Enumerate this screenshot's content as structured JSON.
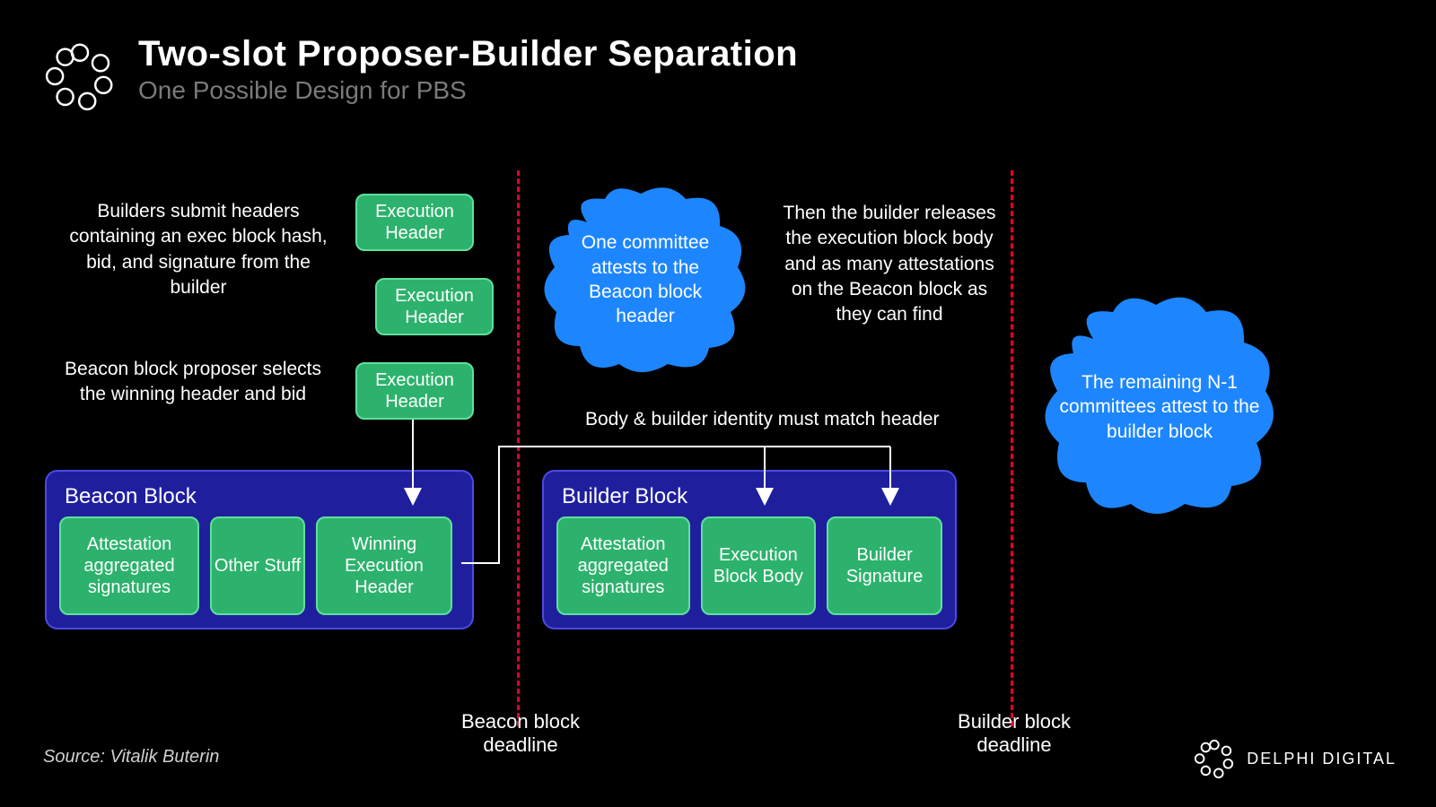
{
  "header": {
    "title": "Two-slot Proposer-Builder Separation",
    "subtitle": "One Possible Design for PBS"
  },
  "desc_builders": "Builders submit headers containing an exec block hash, bid, and signature from the builder",
  "desc_proposer": "Beacon block proposer selects the winning header and bid",
  "desc_release": "Then the builder releases the execution block body and as many attestations on the Beacon block as they can find",
  "exec_headers": [
    "Execution Header",
    "Execution Header",
    "Execution Header"
  ],
  "beacon_block": {
    "title": "Beacon Block",
    "cells": [
      "Attestation aggregated signatures",
      "Other Stuff",
      "Winning Execution Header"
    ]
  },
  "builder_block": {
    "title": "Builder Block",
    "cells": [
      "Attestation aggregated signatures",
      "Execution Block Body",
      "Builder Signature"
    ]
  },
  "cloud1": "One committee attests to the Beacon block header",
  "cloud2": "The remaining N-1 committees attest to the builder block",
  "match_annot": "Body & builder identity must match header",
  "deadline1": "Beacon block deadline",
  "deadline2": "Builder block deadline",
  "source": "Source: Vitalik Buterin",
  "brand": "DELPHI DIGITAL",
  "colors": {
    "green": "#2cb26c",
    "green_border": "#5fe09b",
    "blue_block": "#1f1f9e",
    "blue_block_border": "#4a4ae6",
    "cloud": "#1d86ff",
    "red": "#e4002b"
  }
}
